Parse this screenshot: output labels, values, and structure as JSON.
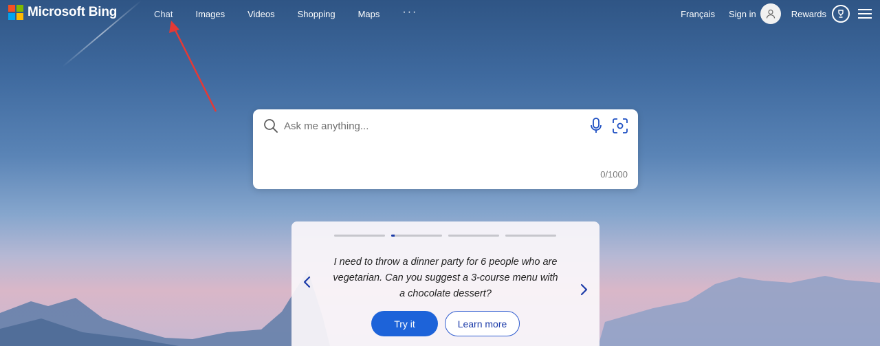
{
  "header": {
    "logo_text": "Microsoft Bing",
    "nav": [
      {
        "label": "Chat"
      },
      {
        "label": "Images"
      },
      {
        "label": "Videos"
      },
      {
        "label": "Shopping"
      },
      {
        "label": "Maps"
      },
      {
        "label": "···"
      }
    ],
    "language": "Français",
    "signin": "Sign in",
    "rewards": "Rewards"
  },
  "search": {
    "placeholder": "Ask me anything...",
    "counter": "0/1000"
  },
  "card": {
    "progress": [
      0,
      0.07,
      0,
      0
    ],
    "prompt": "I need to throw a dinner party for 6 people who are vegetarian. Can you suggest a 3-course menu with a chocolate dessert?",
    "try_label": "Try it",
    "learn_label": "Learn more"
  },
  "colors": {
    "annotation": "#e53935",
    "logo": [
      "#f25022",
      "#7fba00",
      "#00a4ef",
      "#ffb900"
    ],
    "primary": "#1d63d9"
  }
}
